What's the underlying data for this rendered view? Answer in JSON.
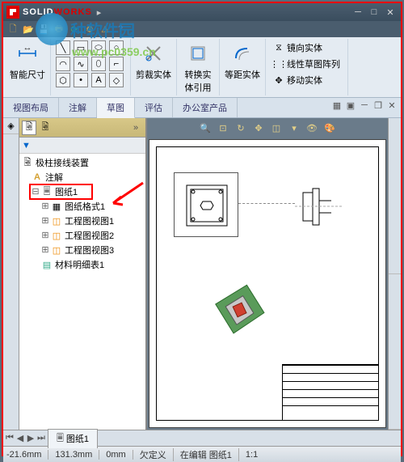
{
  "app": {
    "name_s": "SOLID",
    "name_w": "WORKS"
  },
  "watermark": {
    "text1": "种软件园",
    "text2": "www.pc0359.cn"
  },
  "ribbon": {
    "dim_label": "智能尺寸",
    "trim_label": "剪裁实体",
    "convert_label": "转换实体引用",
    "offset_label": "等距实体",
    "mirror_label": "镜向实体",
    "pattern_label": "线性草图阵列",
    "move_label": "移动实体"
  },
  "tabs": [
    "视图布局",
    "注解",
    "草图",
    "评估",
    "办公室产品"
  ],
  "active_tab": 2,
  "tree": {
    "root": "极柱接线装置",
    "items": [
      {
        "label": "注解",
        "icon": "A",
        "color": "#d4a030"
      },
      {
        "label": "图纸1",
        "icon": "sheet",
        "highlighted": true,
        "children": [
          {
            "label": "图纸格式1",
            "icon": "format"
          },
          {
            "label": "工程图视图1",
            "icon": "view"
          },
          {
            "label": "工程图视图2",
            "icon": "view"
          },
          {
            "label": "工程图视图3",
            "icon": "view"
          },
          {
            "label": "材料明细表1",
            "icon": "bom"
          }
        ]
      }
    ]
  },
  "sheet_tabs": [
    "图纸1"
  ],
  "status": {
    "x": "-21.6mm",
    "y": "131.3mm",
    "z": "0mm",
    "state": "欠定义",
    "mode": "在编辑 图纸1",
    "sel": "1:1"
  },
  "colors": {
    "accent": "#d00",
    "highlight": "red",
    "toolbar": "#d4a84a"
  }
}
